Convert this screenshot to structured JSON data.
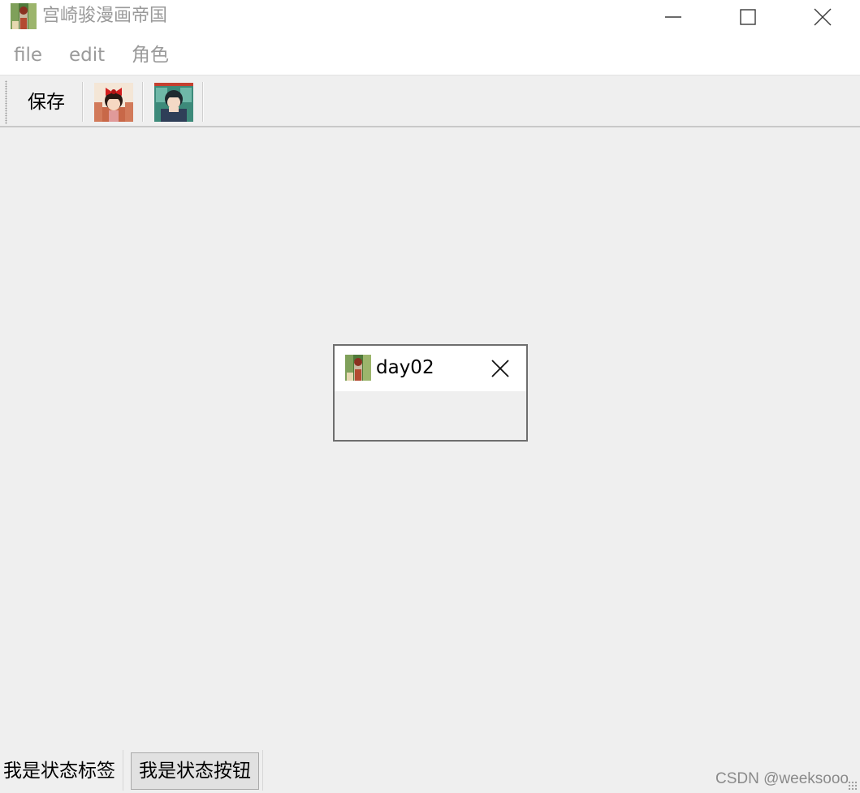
{
  "window": {
    "title": "宫崎骏漫画帝国",
    "app_icon": "anime-picture-icon",
    "controls": [
      "minimize-icon",
      "maximize-icon",
      "close-icon"
    ]
  },
  "menubar": {
    "items": [
      {
        "label": "file"
      },
      {
        "label": "edit"
      },
      {
        "label": "角色"
      }
    ]
  },
  "toolbar": {
    "save_label": "保存",
    "tools": [
      {
        "icon": "kiki-red-bow-avatar-icon"
      },
      {
        "icon": "kiki-portrait-avatar-icon"
      }
    ]
  },
  "dock": {
    "title": "day02",
    "icon": "anime-picture-icon",
    "close_icon": "close-icon"
  },
  "statusbar": {
    "label": "我是状态标签",
    "button_label": "我是状态按钮"
  },
  "watermark": "CSDN @weeksooo",
  "colors": {
    "chrome_background": "#ffffff",
    "main_background": "#efefef",
    "muted_text": "#9a9a9a",
    "dock_border": "#6e6e6e"
  }
}
